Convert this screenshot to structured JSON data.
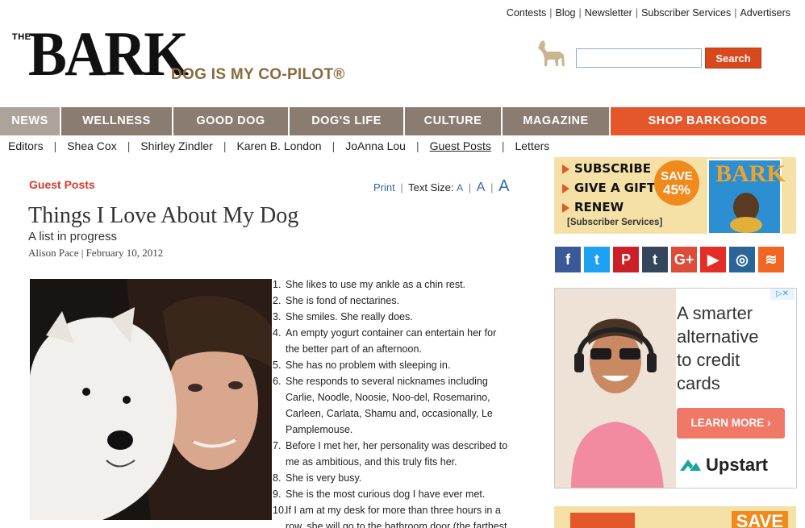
{
  "toplinks": [
    "Contests",
    "Blog",
    "Newsletter",
    "Subscriber Services",
    "Advertisers"
  ],
  "logo": {
    "the": "THE",
    "name": "BARK",
    "tagline": "DOG IS MY CO-PILOT®"
  },
  "search": {
    "button": "Search",
    "value": ""
  },
  "nav": [
    {
      "label": "NEWS",
      "active": true
    },
    {
      "label": "WELLNESS"
    },
    {
      "label": "GOOD DOG"
    },
    {
      "label": "DOG'S LIFE"
    },
    {
      "label": "CULTURE"
    },
    {
      "label": "MAGAZINE"
    },
    {
      "label": "SHOP BARKGOODS"
    }
  ],
  "subnav": [
    "Editors",
    "Shea Cox",
    "Shirley Zindler",
    "Karen B. London",
    "JoAnna Lou",
    "Guest Posts",
    "Letters"
  ],
  "article": {
    "section": "Guest Posts",
    "tools": {
      "print": "Print",
      "text_size": "Text Size:",
      "a": "A"
    },
    "title": "Things I Love About My Dog",
    "subtitle": "A list in progress",
    "byline": "Alison Pace | February 10, 2012",
    "list": [
      [
        "She likes to use my ankle as a chin rest."
      ],
      [
        "She is fond of nectarines."
      ],
      [
        "She smiles. She really does."
      ],
      [
        "An empty yogurt container can entertain her for",
        "the better part of an afternoon."
      ],
      [
        "She has no problem with sleeping in."
      ],
      [
        "She responds to several nicknames including",
        "Carlie, Noodle, Noosie, Noo-del, Rosemarino,",
        "Carleen, Carlata, Shamu and, occasionally, Le",
        "Pamplemouse."
      ],
      [
        "Before I met her, her personality was described to",
        "me as ambitious, and this truly fits her."
      ],
      [
        "She is very busy."
      ],
      [
        "She is the most curious dog I have ever met."
      ],
      [
        "If I am at my desk for more than three hours in a",
        "row, she will go to the bathroom door (the farthest"
      ]
    ]
  },
  "promo": {
    "lines": [
      "SUBSCRIBE",
      "GIVE A GIFT",
      "RENEW"
    ],
    "services": "[Subscriber Services]",
    "badge": [
      "SAVE",
      "45%"
    ],
    "mag_title": "BARK"
  },
  "social": [
    {
      "name": "facebook",
      "glyph": "f",
      "color": "#3b5998"
    },
    {
      "name": "twitter",
      "glyph": "t",
      "color": "#1da1f2"
    },
    {
      "name": "pinterest",
      "glyph": "P",
      "color": "#cb2027"
    },
    {
      "name": "tumblr",
      "glyph": "t",
      "color": "#35465c"
    },
    {
      "name": "google-plus",
      "glyph": "G+",
      "color": "#dd4b39"
    },
    {
      "name": "youtube",
      "glyph": "▶",
      "color": "#e52d27"
    },
    {
      "name": "instagram",
      "glyph": "◎",
      "color": "#2a6597"
    },
    {
      "name": "rss",
      "glyph": "≋",
      "color": "#f26522"
    }
  ],
  "ad": {
    "headline": [
      "A smarter",
      "alternative",
      "to credit",
      "cards"
    ],
    "cta": "LEARN MORE ›",
    "brand": "Upstart"
  },
  "promo2": {
    "save": "SAVE"
  }
}
